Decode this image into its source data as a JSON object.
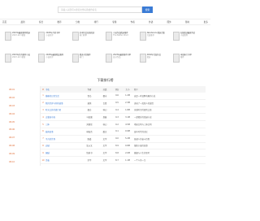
{
  "search": {
    "placeholder": "请输入关键词以搜索文章标题或作者名",
    "button": "搜索"
  },
  "nav": [
    "首页",
    "最新",
    "综合",
    "推荐",
    "分类",
    "排行",
    "专题",
    "作者",
    "外语",
    "国外",
    "随时",
    "更多"
  ],
  "featured": [
    {
      "title": "2023年最新推荐精选",
      "sub": "2023.12.1更新"
    },
    {
      "title": "2023年月的书单",
      "sub": "小说好评"
    },
    {
      "title": "全本作品在线阅读",
      "sub": "热门榜单"
    },
    {
      "title": "小说作品精选推荐",
      "sub": "The Better Word"
    },
    {
      "title": "Wanderers 精选合集",
      "sub": "完结推荐"
    },
    {
      "title": "在线阅读最新作品",
      "sub": "小说推荐"
    }
  ],
  "featured2": [
    {
      "title": "2023年月的推荐小说",
      "sub": "2023.12.1更新"
    },
    {
      "title": "2023年最新精品推荐",
      "sub": "小说好评"
    },
    {
      "title": "精选书目推荐",
      "sub": "热门"
    },
    {
      "title": "2023年最新推荐书单",
      "sub": "高分作品"
    },
    {
      "title": "2022年完结作品",
      "sub": "精选"
    },
    {
      "title": "本周热门书单",
      "sub": "推荐"
    }
  ],
  "rank_title": "下载排行榜",
  "side_dates": [
    "08-01",
    "08-02",
    "08-03",
    "08-04",
    "08-05",
    "08-06",
    "08-07",
    "08-08",
    "08-09",
    "08-10",
    "08-11"
  ],
  "table": {
    "headers": [
      "#",
      "书名",
      "作者",
      "分类",
      "评分",
      "大小",
      "简介"
    ],
    "rows": [
      [
        "1",
        "猫咪的日常生活",
        "青岛",
        "都市",
        "9.6",
        "1.2M",
        "这是一本温馨有趣的小说"
      ],
      [
        "2",
        "我的世界与你的故事",
        "萧然",
        "言情",
        "9.5",
        "2.3M",
        "讲述了一段感人的爱情"
      ],
      [
        "3",
        "时光之外的旅行者",
        "墨白",
        "科幻",
        "9.4",
        "1.8M",
        "穿越时空的冒险之旅"
      ],
      [
        "4",
        "古董局中局",
        "马伯庸",
        "悬疑",
        "9.3",
        "3.1M",
        "一部精彩的悬疑小说"
      ],
      [
        "5",
        "三体",
        "刘慈欣",
        "科幻",
        "9.2",
        "4.5M",
        "地球文明与三体文明"
      ],
      [
        "6",
        "城南旧事",
        "林海音",
        "散文",
        "9.1",
        "0.9M",
        "童年时代的回忆"
      ],
      [
        "7",
        "平凡的世界",
        "路遥",
        "文学",
        "9.0",
        "5.2M",
        "普通人的奋斗历程"
      ],
      [
        "8",
        "边城",
        "沈从文",
        "文学",
        "8.9",
        "0.8M",
        "湘西小城的故事"
      ],
      [
        "9",
        "围城",
        "钱钟书",
        "文学",
        "8.8",
        "2.0M",
        "婚姻与人生的思考"
      ],
      [
        "10",
        "活着",
        "余华",
        "文学",
        "8.7",
        "1.1M",
        "一个人的一生"
      ]
    ]
  }
}
